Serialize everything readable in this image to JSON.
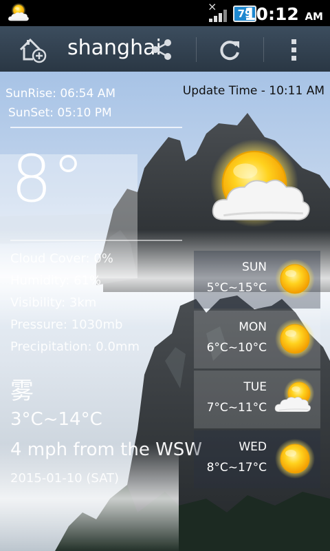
{
  "status_bar": {
    "battery": "79",
    "time": "10:12",
    "ampm": "AM"
  },
  "action_bar": {
    "city": "shanghai",
    "icons": [
      "add-location-icon",
      "share-icon",
      "refresh-icon",
      "overflow-menu-icon"
    ]
  },
  "sun": {
    "sunrise": "SunRise: 06:54 AM",
    "sunset": "SunSet: 05:10 PM"
  },
  "update_time": "Update Time - 10:11 AM",
  "current": {
    "temperature": "8°",
    "icon": "partly-cloudy-icon",
    "cloud_cover": "Cloud Cover: 0%",
    "humidity": "Humidity: 61%",
    "visibility": "Visibility: 3km",
    "pressure": "Pressure: 1030mb",
    "precipitation": "Precipitation: 0.0mm",
    "condition": "雾",
    "range": "3°C~14°C",
    "wind": "4 mph from the WSW",
    "date": "2015-01-10 (SAT)"
  },
  "forecast": [
    {
      "day": "SUN",
      "range": "5°C~15°C",
      "icon": "sunny-icon"
    },
    {
      "day": "MON",
      "range": "6°C~10°C",
      "icon": "sunny-icon"
    },
    {
      "day": "TUE",
      "range": "7°C~11°C",
      "icon": "partly-cloudy-icon"
    },
    {
      "day": "WED",
      "range": "8°C~17°C",
      "icon": "sunny-icon"
    }
  ],
  "colors": {
    "action_bar": "#34414f",
    "battery": "#1e88d0",
    "sun": "#ffc21a"
  }
}
